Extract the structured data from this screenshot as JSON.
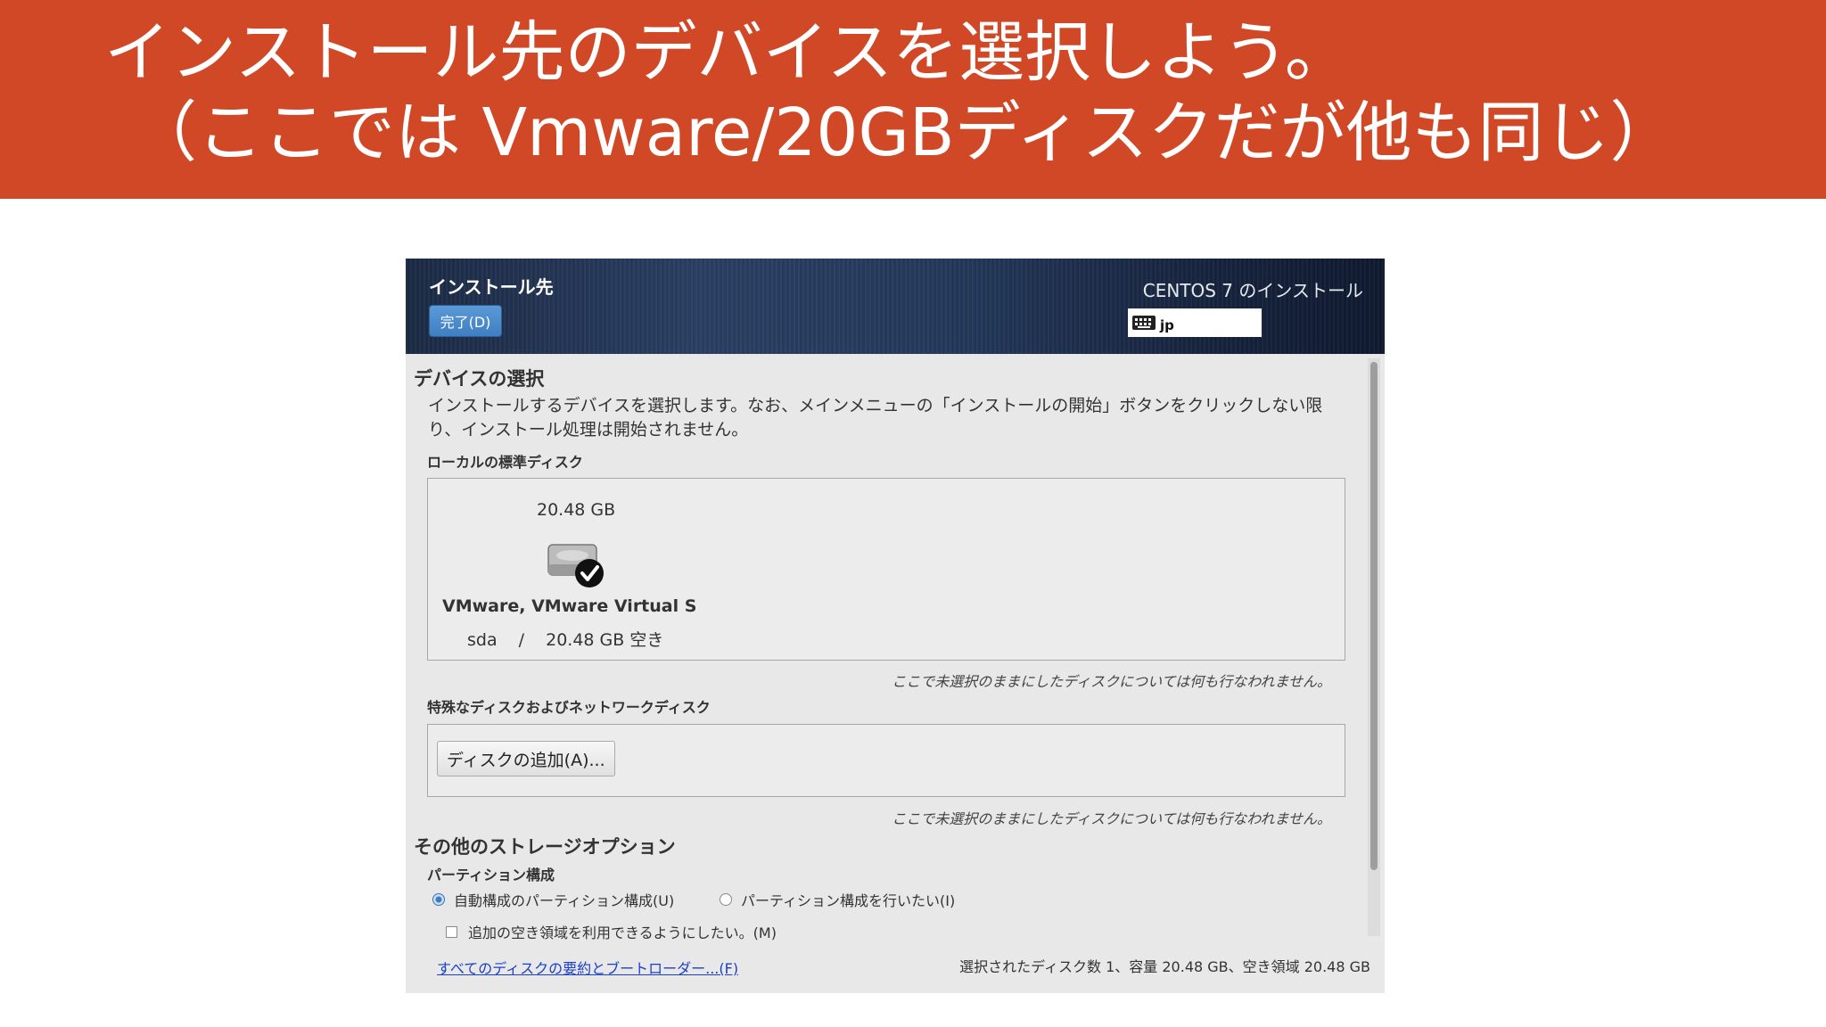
{
  "slide": {
    "title_line1": "インストール先のデバイスを選択しよう。",
    "title_line2": "（ここでは Vmware/20GBディスクだが他も同じ）"
  },
  "window": {
    "spoke_title": "インストール先",
    "done_label": "完了(D)",
    "product_title": "CENTOS 7 のインストール",
    "keyboard_layout": "jp",
    "keyboard_icon": "keyboard-icon"
  },
  "device_selection": {
    "heading": "デバイスの選択",
    "description": "インストールするデバイスを選択します。なお、メインメニューの「インストールの開始」ボタンをクリックしない限り、インストール処理は開始されません。",
    "local_disks_label": "ローカルの標準ディスク",
    "disks": [
      {
        "size": "20.48 GB",
        "name": "VMware, VMware Virtual S",
        "device": "sda",
        "separator": "/",
        "free": "20.48 GB 空き",
        "selected": true,
        "icon": "hard-disk-icon"
      }
    ],
    "unselected_note": "ここで未選択のままにしたディスクについては何も行なわれません。",
    "special_disks_label": "特殊なディスクおよびネットワークディスク",
    "add_disk_label": "ディスクの追加(A)...",
    "special_note": "ここで未選択のままにしたディスクについては何も行なわれません。"
  },
  "storage_options": {
    "heading": "その他のストレージオプション",
    "partitioning_label": "パーティション構成",
    "auto_partition_label": "自動構成のパーティション構成(U)",
    "manual_partition_label": "パーティション構成を行いたい(I)",
    "selected_partitioning": "auto",
    "reclaim_label": "追加の空き領域を利用できるようにしたい。(M)",
    "reclaim_checked": false
  },
  "footer": {
    "summary_link": "すべてのディスクの要約とブートローダー...(F)",
    "summary_text": "選択されたディスク数 1、容量 20.48 GB、空き領域 20.48 GB"
  },
  "colors": {
    "slide_header": "#d14827",
    "topbar": "#1c2b45",
    "done_button": "#4a8ccd",
    "link": "#1a3fc8"
  }
}
